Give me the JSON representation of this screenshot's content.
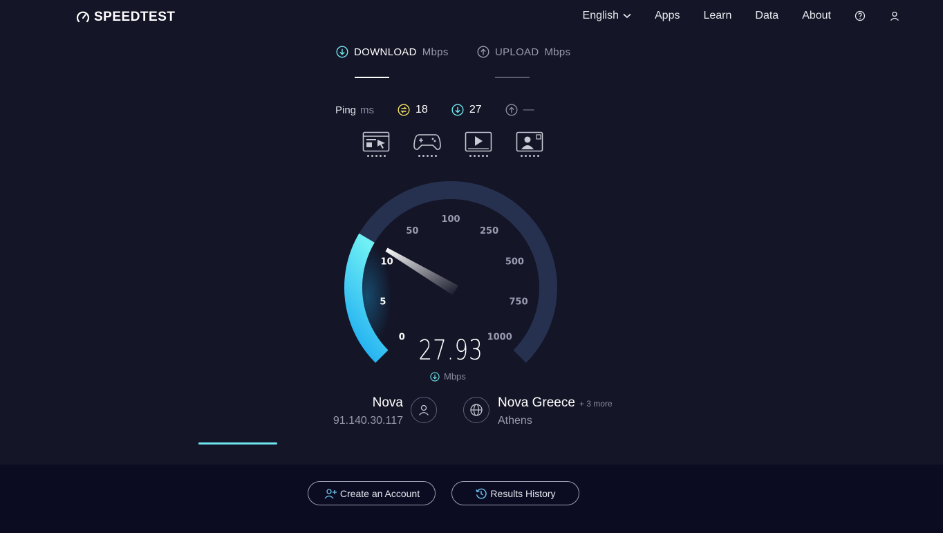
{
  "brand": {
    "name": "SPEEDTEST"
  },
  "nav": {
    "language": "English",
    "items": [
      "Apps",
      "Learn",
      "Data",
      "About"
    ]
  },
  "tabs": {
    "download": {
      "label": "DOWNLOAD",
      "unit": "Mbps"
    },
    "upload": {
      "label": "UPLOAD",
      "unit": "Mbps"
    }
  },
  "ping": {
    "label": "Ping",
    "unit": "ms",
    "idle": "18",
    "download": "27",
    "upload": "—"
  },
  "gauge": {
    "ticks": [
      "0",
      "5",
      "10",
      "50",
      "100",
      "250",
      "500",
      "750",
      "1000"
    ],
    "value": "27.93",
    "unit": "Mbps",
    "fill_fraction": 0.28
  },
  "connection": {
    "isp": "Nova",
    "ip": "91.140.30.117",
    "server": "Nova Greece",
    "server_more": "+ 3 more",
    "city": "Athens"
  },
  "footer": {
    "create_account": "Create an Account",
    "results_history": "Results History"
  },
  "colors": {
    "background": "#141526",
    "footer": "#0b0b22",
    "accent_cyan": "#6fe6ee",
    "gauge_track": "#26314f",
    "gauge_fill_start": "#19a8f0",
    "gauge_fill_end": "#6ff0f5"
  }
}
